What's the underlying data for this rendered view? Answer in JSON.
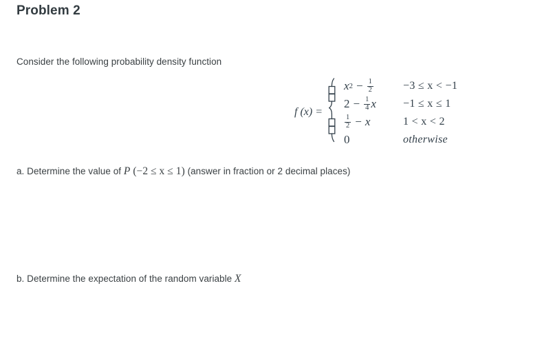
{
  "document": {
    "title": "Problem 2",
    "prompt": "Consider the following probability density function",
    "text_color": "#3a4043",
    "title_color": "#333c41",
    "math_color": "#33404a",
    "background": "#ffffff"
  },
  "function_definition": {
    "label": "f (x) =",
    "brace": "left-curly-brace",
    "pieces": [
      {
        "expression_parts": {
          "base": "x",
          "exponent": "2",
          "operator": "−",
          "fraction_num": "1",
          "fraction_den": "2"
        },
        "expression_plain": "x² − 1/2",
        "condition": "−3 ≤ x < −1",
        "condition_italic": false
      },
      {
        "expression_parts": {
          "leading": "2",
          "operator": "−",
          "fraction_num": "1",
          "fraction_den": "4",
          "trailing": "x"
        },
        "expression_plain": "2 − (1/4)x",
        "condition": "−1 ≤ x ≤ 1",
        "condition_italic": false
      },
      {
        "expression_parts": {
          "fraction_num": "1",
          "fraction_den": "2",
          "operator": "−",
          "trailing": "x"
        },
        "expression_plain": "1/2 − x",
        "condition": "1 < x < 2",
        "condition_italic": false
      },
      {
        "expression_parts": {
          "leading": "0"
        },
        "expression_plain": "0",
        "condition": "otherwise",
        "condition_italic": true
      }
    ]
  },
  "questions": [
    {
      "id": "a",
      "prefix": "a. Determine the value of ",
      "symbol": "P",
      "probability_expression": " (−2 ≤ x ≤ 1)",
      "suffix": " (answer in fraction or 2 decimal places)"
    },
    {
      "id": "b",
      "prefix": "b. Determine the expectation of the random variable ",
      "symbol": "X",
      "probability_expression": "",
      "suffix": ""
    }
  ]
}
